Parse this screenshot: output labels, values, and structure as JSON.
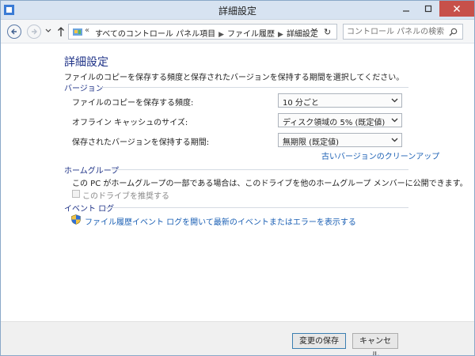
{
  "window": {
    "title": "詳細設定"
  },
  "address": {
    "chevron": "«",
    "breadcrumbs": [
      "すべてのコントロール パネル項目",
      "ファイル履歴",
      "詳細設定"
    ],
    "refresh": "↻"
  },
  "search": {
    "placeholder": "コントロール パネルの検索"
  },
  "page": {
    "title": "詳細設定",
    "description": "ファイルのコピーを保存する頻度と保存されたバージョンを保持する期間を選択してください。"
  },
  "versions": {
    "heading": "バージョン",
    "rows": [
      {
        "label": "ファイルのコピーを保存する頻度:",
        "value": "10 分ごと"
      },
      {
        "label": "オフライン キャッシュのサイズ:",
        "value": "ディスク領域の 5% (既定値)"
      },
      {
        "label": "保存されたバージョンを保持する期間:",
        "value": "無期限 (既定値)"
      }
    ],
    "cleanup_link": "古いバージョンのクリーンアップ"
  },
  "homegroup": {
    "heading": "ホームグループ",
    "description": "この PC がホームグループの一部である場合は、このドライブを他のホームグループ メンバーに公開できます。",
    "checkbox_label": "このドライブを推奨する"
  },
  "eventlog": {
    "heading": "イベント ログ",
    "link": "ファイル履歴イベント ログを開いて最新のイベントまたはエラーを表示する"
  },
  "footer": {
    "save_label": "変更の保存",
    "cancel_label": "キャンセル"
  },
  "colors": {
    "accent": "#1e3287",
    "link": "#1a5fb4",
    "close": "#c7504a"
  }
}
